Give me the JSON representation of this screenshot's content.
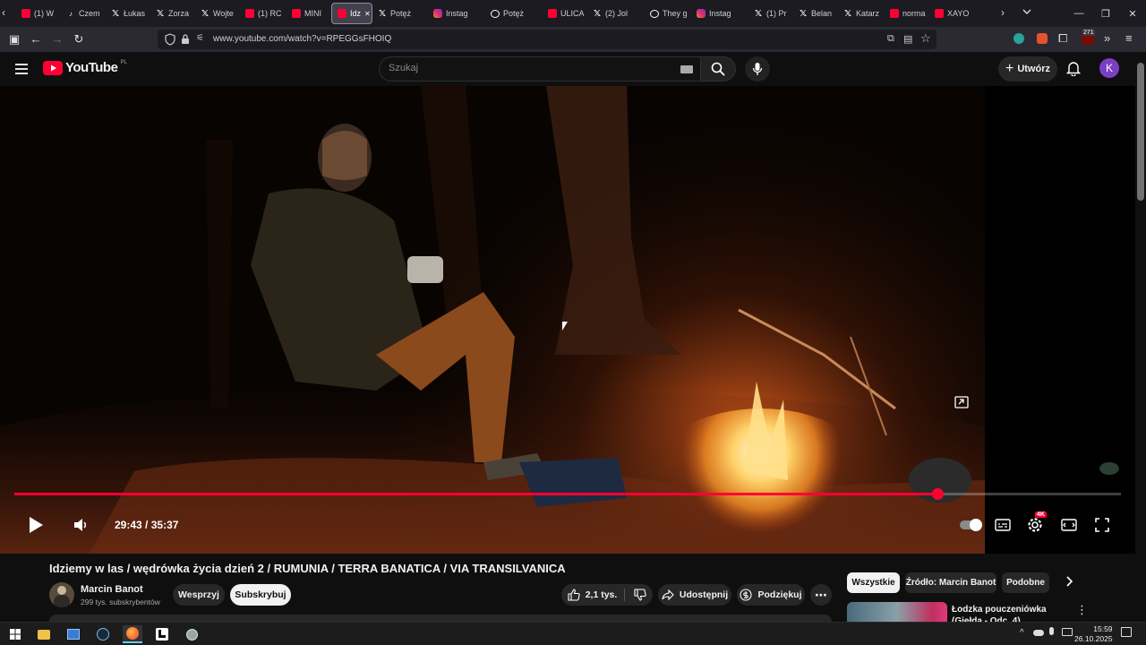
{
  "browser": {
    "tabs": [
      {
        "label": "(1) W",
        "icon": "youtube"
      },
      {
        "label": "Czem",
        "icon": "tiktok"
      },
      {
        "label": "Łukas",
        "icon": "x"
      },
      {
        "label": "Zorza",
        "icon": "x"
      },
      {
        "label": "Wojte",
        "icon": "x"
      },
      {
        "label": "(1) RC",
        "icon": "youtube"
      },
      {
        "label": "MINI",
        "icon": "youtube"
      },
      {
        "label": "Idz",
        "icon": "youtube"
      },
      {
        "label": "Potęż",
        "icon": "x"
      },
      {
        "label": "Instag",
        "icon": "instagram"
      },
      {
        "label": "Potęż",
        "icon": "chrome"
      },
      {
        "label": "ULICA",
        "icon": "youtube"
      },
      {
        "label": "(2) Jol",
        "icon": "x"
      },
      {
        "label": "They g",
        "icon": "chrome"
      },
      {
        "label": "Instag",
        "icon": "instagram"
      },
      {
        "label": "(1) Pr",
        "icon": "x"
      },
      {
        "label": "Belan",
        "icon": "x"
      },
      {
        "label": "Katarz",
        "icon": "x"
      },
      {
        "label": "norma",
        "icon": "youtube"
      },
      {
        "label": "XAYO",
        "icon": "youtube"
      }
    ],
    "active_tab_index": 7,
    "url": "www.youtube.com/watch?v=RPEGGsFHOIQ",
    "extension_badge": "271"
  },
  "youtube": {
    "logo_text": "YouTube",
    "logo_region": "PL",
    "search_placeholder": "Szukaj",
    "create_label": "Utwórz",
    "avatar_letter": "K",
    "brand_color": "#ff0033"
  },
  "player": {
    "current_time": "29:43",
    "duration": "35:37",
    "time_separator": "/",
    "progress_fraction": 0.8345,
    "quality_badge": "4K"
  },
  "video": {
    "title": "Idziemy w las / wędrówka życia dzień 2 / RUMUNIA / TERRA BANATICA / VIA TRANSILVANICA",
    "channel_name": "Marcin Banot",
    "subscribers": "299 tys. subskrybentów",
    "support_label": "Wesprzyj",
    "subscribe_label": "Subskrybuj",
    "likes": "2,1 tys.",
    "share_label": "Udostępnij",
    "thanks_label": "Podziękuj"
  },
  "recommendations": {
    "chips": [
      "Wszystkie",
      "Źródło: Marcin Banot",
      "Podobne"
    ],
    "active_chip": 0,
    "first_item_title": "Łodzka pouczeniówka (Giełda - Odc. 4)"
  },
  "taskbar": {
    "time": "15:59",
    "date": "26.10.2025"
  }
}
